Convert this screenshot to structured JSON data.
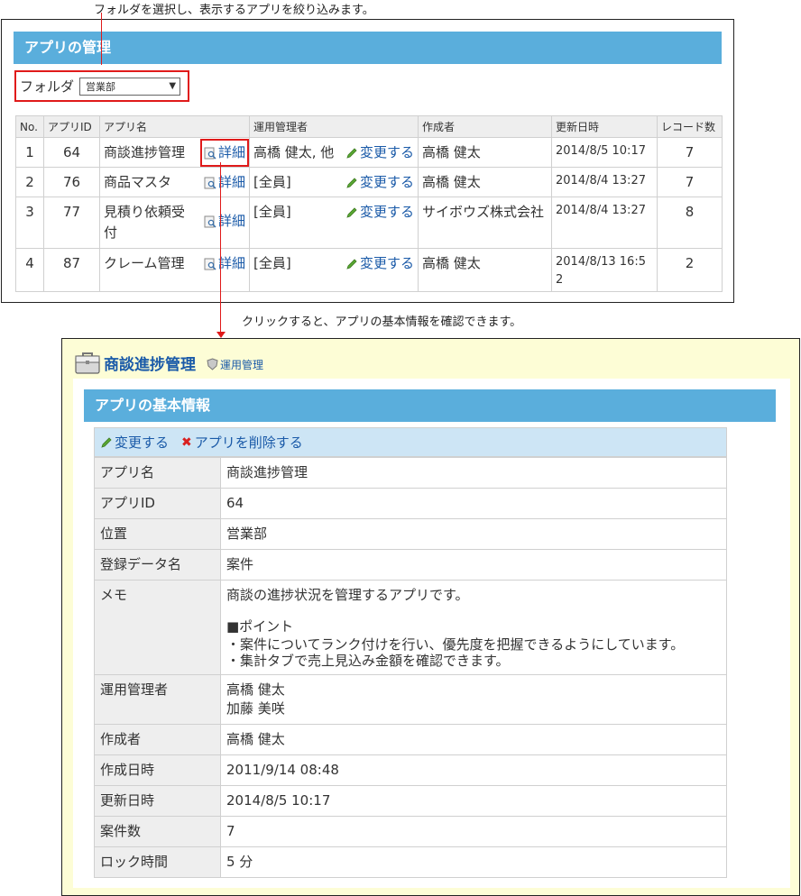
{
  "annotations": {
    "top": "フォルダを選択し、表示するアプリを絞り込みます。",
    "middle": "クリックすると、アプリの基本情報を確認できます。"
  },
  "list_panel": {
    "title": "アプリの管理",
    "folder_label": "フォルダ",
    "folder_selected": "営業部",
    "columns": [
      "No.",
      "アプリID",
      "アプリ名",
      "運用管理者",
      "作成者",
      "更新日時",
      "レコード数"
    ],
    "detail_label": "詳細",
    "change_label": "変更する",
    "rows": [
      {
        "no": "1",
        "id": "64",
        "name": "商談進捗管理",
        "admin": "高橋 健太, 他",
        "creator": "高橋 健太",
        "updated": "2014/8/5 10:17",
        "records": "7"
      },
      {
        "no": "2",
        "id": "76",
        "name": "商品マスタ",
        "admin": "[全員]",
        "creator": "高橋 健太",
        "updated": "2014/8/4 13:27",
        "records": "7"
      },
      {
        "no": "3",
        "id": "77",
        "name": "見積り依頼受付",
        "admin": "[全員]",
        "creator": "サイボウズ株式会社",
        "updated": "2014/8/4 13:27",
        "records": "8"
      },
      {
        "no": "4",
        "id": "87",
        "name": "クレーム管理",
        "admin": "[全員]",
        "creator": "高橋 健太",
        "updated": "2014/8/13 16:52",
        "records": "2"
      }
    ]
  },
  "detail_panel": {
    "app_name": "商談進捗管理",
    "role_link": "運用管理",
    "section_title": "アプリの基本情報",
    "action_edit": "変更する",
    "action_delete": "アプリを削除する",
    "fields": {
      "app_name": {
        "label": "アプリ名",
        "value": "商談進捗管理"
      },
      "app_id": {
        "label": "アプリID",
        "value": "64"
      },
      "location": {
        "label": "位置",
        "value": "営業部"
      },
      "data_name": {
        "label": "登録データ名",
        "value": "案件"
      },
      "memo": {
        "label": "メモ",
        "line1": "商談の進捗状況を管理するアプリです。",
        "line2": "■ポイント",
        "line3": "・案件についてランク付けを行い、優先度を把握できるようにしています。",
        "line4": "・集計タブで売上見込み金額を確認できます。"
      },
      "admins": {
        "label": "運用管理者",
        "value1": "高橋 健太",
        "value2": "加藤 美咲"
      },
      "creator": {
        "label": "作成者",
        "value": "高橋 健太"
      },
      "created": {
        "label": "作成日時",
        "value": "2011/9/14 08:48"
      },
      "updated": {
        "label": "更新日時",
        "value": "2014/8/5 10:17"
      },
      "record_count": {
        "label": "案件数",
        "value": "7"
      },
      "lock_time": {
        "label": "ロック時間",
        "value": "5 分"
      }
    }
  },
  "colors": {
    "header_bar": "#5aaedc",
    "link": "#1a5aa8",
    "highlight": "#e01a1a",
    "detail_bg": "#fdfdd6",
    "action_bar": "#cde5f5"
  }
}
